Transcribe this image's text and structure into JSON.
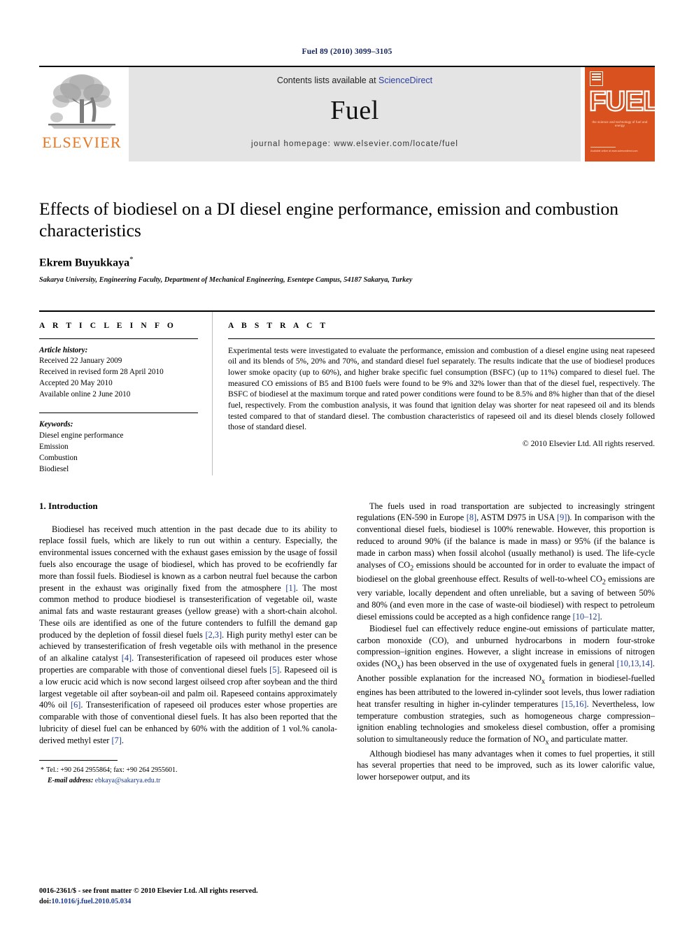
{
  "running_head": "Fuel 89 (2010) 3099–3105",
  "masthead": {
    "publisher": "ELSEVIER",
    "contents_prefix": "Contents lists available at ",
    "contents_link": "ScienceDirect",
    "journal_name": "Fuel",
    "homepage": "journal homepage: www.elsevier.com/locate/fuel",
    "cover": {
      "title": "FUEL",
      "subtitle": "the science and technology of fuel and energy",
      "footer": "Available online at www.sciencedirect.com"
    },
    "colors": {
      "elsevier_orange": "#e87722",
      "cover_orange": "#d9511e",
      "link_blue": "#2b3fa0",
      "banner_gray": "#e4e4e4"
    }
  },
  "article": {
    "title": "Effects of biodiesel on a DI diesel engine performance, emission and combustion characteristics",
    "author": "Ekrem Buyukkaya",
    "author_marker": "*",
    "affiliation": "Sakarya University, Engineering Faculty, Department of Mechanical Engineering, Esentepe Campus, 54187 Sakarya, Turkey"
  },
  "article_info": {
    "heading": "A R T I C L E   I N F O",
    "history_label": "Article history:",
    "history": [
      "Received 22 January 2009",
      "Received in revised form 28 April 2010",
      "Accepted 20 May 2010",
      "Available online 2 June 2010"
    ],
    "keywords_label": "Keywords:",
    "keywords": [
      "Diesel engine performance",
      "Emission",
      "Combustion",
      "Biodiesel"
    ]
  },
  "abstract": {
    "heading": "A B S T R A C T",
    "text": "Experimental tests were investigated to evaluate the performance, emission and combustion of a diesel engine using neat rapeseed oil and its blends of 5%, 20% and 70%, and standard diesel fuel separately. The results indicate that the use of biodiesel produces lower smoke opacity (up to 60%), and higher brake specific fuel consumption (BSFC) (up to 11%) compared to diesel fuel. The measured CO emissions of B5 and B100 fuels were found to be 9% and 32% lower than that of the diesel fuel, respectively. The BSFC of biodiesel at the maximum torque and rated power conditions were found to be 8.5% and 8% higher than that of the diesel fuel, respectively. From the combustion analysis, it was found that ignition delay was shorter for neat rapeseed oil and its blends tested compared to that of standard diesel. The combustion characteristics of rapeseed oil and its diesel blends closely followed those of standard diesel.",
    "copyright": "© 2010 Elsevier Ltd. All rights reserved."
  },
  "body": {
    "section_heading": "1. Introduction",
    "left_paragraphs": [
      "Biodiesel has received much attention in the past decade due to its ability to replace fossil fuels, which are likely to run out within a century. Especially, the environmental issues concerned with the exhaust gases emission by the usage of fossil fuels also encourage the usage of biodiesel, which has proved to be ecofriendly far more than fossil fuels. Biodiesel is known as a carbon neutral fuel because the carbon present in the exhaust was originally fixed from the atmosphere [1]. The most common method to produce biodiesel is transesterification of vegetable oil, waste animal fats and waste restaurant greases (yellow grease) with a short-chain alcohol. These oils are identified as one of the future contenders to fulfill the demand gap produced by the depletion of fossil diesel fuels [2,3]. High purity methyl ester can be achieved by transesterification of fresh vegetable oils with methanol in the presence of an alkaline catalyst [4]. Transesterification of rapeseed oil produces ester whose properties are comparable with those of conventional diesel fuels [5]. Rapeseed oil is a low erucic acid which is now second largest oilseed crop after soybean and the third largest vegetable oil after soybean-oil and palm oil. Rapeseed contains approximately 40% oil [6]. Transesterification of rapeseed oil produces ester whose properties are comparable with those of conventional diesel fuels. It has also been reported that the lubricity of diesel fuel can be enhanced by 60% with the addition of 1 vol.% canola-derived methyl ester [7]."
    ],
    "right_paragraphs": [
      "The fuels used in road transportation are subjected to increasingly stringent regulations (EN-590 in Europe [8], ASTM D975 in USA [9]). In comparison with the conventional diesel fuels, biodiesel is 100% renewable. However, this proportion is reduced to around 90% (if the balance is made in mass) or 95% (if the balance is made in carbon mass) when fossil alcohol (usually methanol) is used. The life-cycle analyses of CO2 emissions should be accounted for in order to evaluate the impact of biodiesel on the global greenhouse effect. Results of well-to-wheel CO2 emissions are very variable, locally dependent and often unreliable, but a saving of between 50% and 80% (and even more in the case of waste-oil biodiesel) with respect to petroleum diesel emissions could be accepted as a high confidence range [10–12].",
      "Biodiesel fuel can effectively reduce engine-out emissions of particulate matter, carbon monoxide (CO), and unburned hydrocarbons in modern four-stroke compression–ignition engines. However, a slight increase in emissions of nitrogen oxides (NOx) has been observed in the use of oxygenated fuels in general [10,13,14]. Another possible explanation for the increased NOx formation in biodiesel-fuelled engines has been attributed to the lowered in-cylinder soot levels, thus lower radiation heat transfer resulting in higher in-cylinder temperatures [15,16]. Nevertheless, low temperature combustion strategies, such as homogeneous charge compression–ignition enabling technologies and smokeless diesel combustion, offer a promising solution to simultaneously reduce the formation of NOx and particulate matter.",
      "Although biodiesel has many advantages when it comes to fuel properties, it still has several properties that need to be improved, such as its lower calorific value, lower horsepower output, and its"
    ]
  },
  "footnote": {
    "marker": "*",
    "tel": "Tel.: +90 264 2955864; fax: +90 264 2955601.",
    "email_label": "E-mail address:",
    "email": "ebkaya@sakarya.edu.tr"
  },
  "imprint": {
    "line1": "0016-2361/$ - see front matter © 2010 Elsevier Ltd. All rights reserved.",
    "doi_label": "doi:",
    "doi": "10.1016/j.fuel.2010.05.034"
  }
}
